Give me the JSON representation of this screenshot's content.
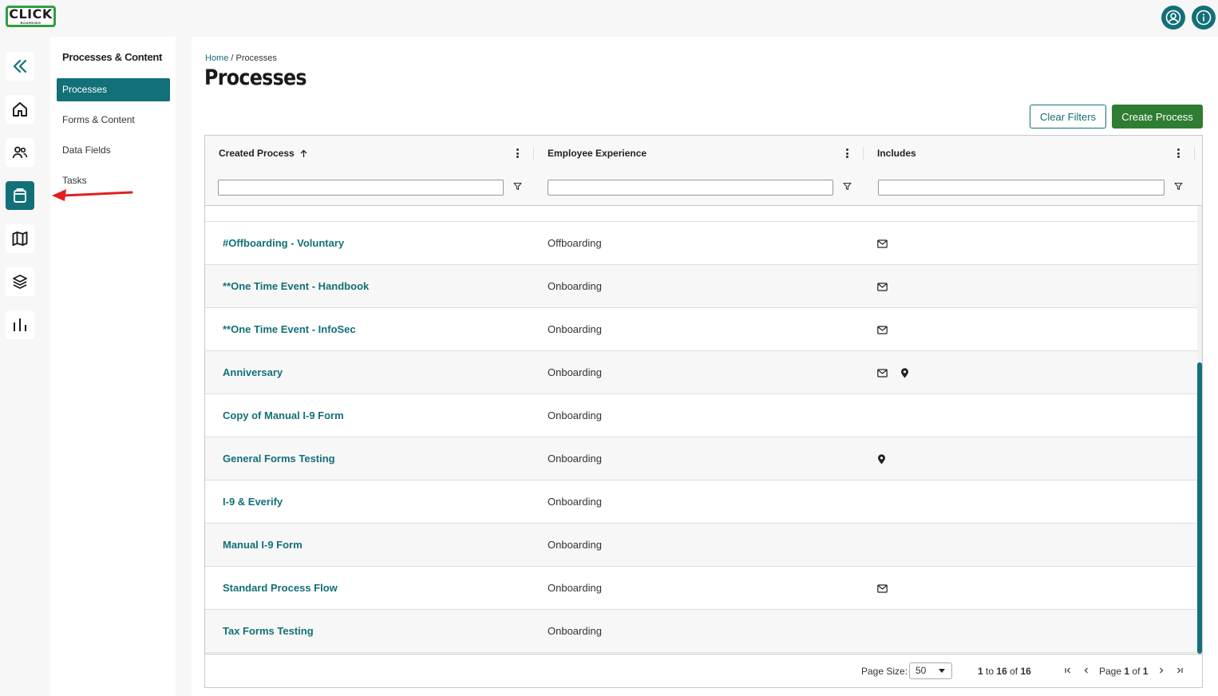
{
  "app": {
    "logo_text": "CLICK",
    "logo_subtext": "BOARDING"
  },
  "subnav": {
    "title": "Processes & Content",
    "items": [
      {
        "label": "Processes"
      },
      {
        "label": "Forms & Content"
      },
      {
        "label": "Data Fields"
      },
      {
        "label": "Tasks"
      }
    ]
  },
  "breadcrumb": {
    "home": "Home",
    "separator": "/",
    "current": "Processes"
  },
  "page": {
    "title": "Processes"
  },
  "actions": {
    "clear_filters": "Clear Filters",
    "create_process": "Create Process"
  },
  "grid": {
    "columns": [
      {
        "label": "Created Process",
        "sort": "ascending"
      },
      {
        "label": "Employee Experience"
      },
      {
        "label": "Includes"
      }
    ],
    "rows": [
      {
        "name": "#Offboarding - Voluntary",
        "experience": "Offboarding",
        "includes": [
          "mail-icon"
        ]
      },
      {
        "name": "**One Time Event - Handbook",
        "experience": "Onboarding",
        "includes": [
          "mail-icon"
        ]
      },
      {
        "name": "**One Time Event - InfoSec",
        "experience": "Onboarding",
        "includes": [
          "mail-icon"
        ]
      },
      {
        "name": "Anniversary",
        "experience": "Onboarding",
        "includes": [
          "mail-icon",
          "location-pin-icon"
        ]
      },
      {
        "name": "Copy of Manual I-9 Form",
        "experience": "Onboarding",
        "includes": []
      },
      {
        "name": "General Forms Testing",
        "experience": "Onboarding",
        "includes": [
          "location-pin-icon"
        ]
      },
      {
        "name": "I-9 & Everify",
        "experience": "Onboarding",
        "includes": []
      },
      {
        "name": "Manual I-9 Form",
        "experience": "Onboarding",
        "includes": []
      },
      {
        "name": "Standard Process Flow",
        "experience": "Onboarding",
        "includes": [
          "mail-icon"
        ]
      },
      {
        "name": "Tax Forms Testing",
        "experience": "Onboarding",
        "includes": []
      }
    ]
  },
  "pagination": {
    "page_size_label": "Page Size:",
    "page_size": "50",
    "range_from": "1",
    "range_to_word": "to",
    "range_to": "16",
    "range_of_word": "of",
    "range_total": "16",
    "page_word": "Page",
    "page_current": "1",
    "page_of_word": "of",
    "page_total": "1"
  },
  "colors": {
    "accent": "#127078",
    "primary_button": "#2e7d32",
    "annotation_arrow": "#e02020"
  }
}
